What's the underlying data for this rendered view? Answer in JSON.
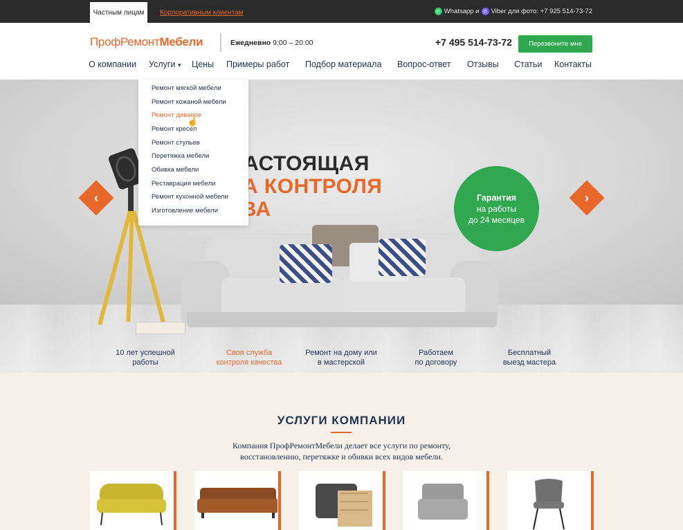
{
  "topbar": {
    "tab_private": "Частным лицам",
    "tab_corporate": "Корпоративным клиентам",
    "messengers_text": "Whatsapp и",
    "viber_text": "Viber для фото: +7 925 514-73-72"
  },
  "header": {
    "logo_part1": "ПрофРемонт",
    "logo_part2": "Мебели",
    "hours_label": "Ежедневно",
    "hours_value": "9:00 – 20:00",
    "phone": "+7 495 514-73-72",
    "callback_button": "Перезвоните мне"
  },
  "nav": {
    "items": [
      "О компании",
      "Услуги",
      "Цены",
      "Примеры работ",
      "Подбор материала",
      "Вопрос-ответ",
      "Отзывы",
      "Статьи",
      "Контакты"
    ]
  },
  "dropdown": {
    "items": [
      "Ремонт мягкой мебели",
      "Ремонт кожаной мебели",
      "Ремонт диванов",
      "Ремонт кресел",
      "Ремонт стульев",
      "Перетяжка мебели",
      "Обивка мебели",
      "Реставрация мебели",
      "Ремонт кухонной мебели",
      "Изготовление мебели"
    ],
    "active_index": 2
  },
  "hero": {
    "line1": "НАСТОЯЩАЯ",
    "line2": "БА КОНТРОЛЯ",
    "line3": "ТВА",
    "guarantee_title": "Гарантия",
    "guarantee_line2": "на работы",
    "guarantee_line3": "до 24 месяцев"
  },
  "features": [
    {
      "line1": "10 лет успешной",
      "line2": "работы"
    },
    {
      "line1": "Своя служба",
      "line2": "контроля качества"
    },
    {
      "line1": "Ремонт на дому или",
      "line2": "в мастерской"
    },
    {
      "line1": "Работаем",
      "line2": "по договору"
    },
    {
      "line1": "Бесплатный",
      "line2": "выезд мастера"
    }
  ],
  "services": {
    "title": "УСЛУГИ КОМПАНИИ",
    "desc_line1": "Компания ПрофРемонтМебели делает все услуги по ремонту,",
    "desc_line2": "восстановлению, перетяжке и обивки всех видов мебели."
  },
  "colors": {
    "accent": "#e8682a",
    "green": "#2fa84f",
    "navy": "#243352",
    "topbar": "#2b2b2b"
  }
}
